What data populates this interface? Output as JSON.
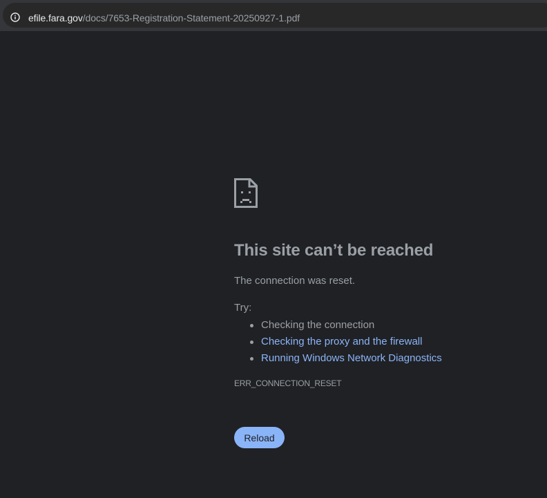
{
  "browser": {
    "url_host": "efile.fara.gov",
    "url_path": "/docs/7653-Registration-Statement-20250927-1.pdf",
    "info_icon": "info-icon"
  },
  "error_page": {
    "icon": "sad-document-icon",
    "title": "This site can’t be reached",
    "message": "The connection was reset.",
    "try_label": "Try:",
    "suggestions": [
      {
        "label": "Checking the connection",
        "is_link": false
      },
      {
        "label": "Checking the proxy and the firewall",
        "is_link": true
      },
      {
        "label": "Running Windows Network Diagnostics",
        "is_link": true
      }
    ],
    "error_code": "ERR_CONNECTION_RESET",
    "reload_label": "Reload"
  },
  "colors": {
    "background": "#202124",
    "toolbar": "#35363a",
    "text": "#9aa0a6",
    "link": "#8ab4f8",
    "button": "#8ab4f8"
  }
}
